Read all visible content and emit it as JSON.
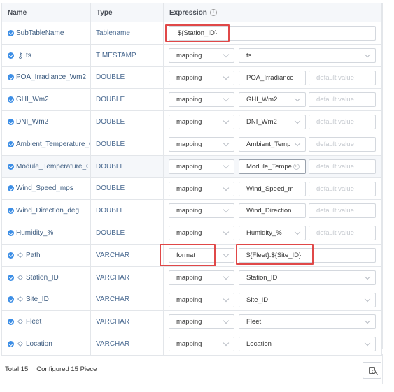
{
  "header": {
    "name": "Name",
    "type": "Type",
    "expression": "Expression",
    "info_icon": "info-icon"
  },
  "rows": [
    {
      "name": "SubTableName",
      "type": "Tablename",
      "icon": "",
      "expr_value": "${Station_ID}"
    },
    {
      "name": "ts",
      "type": "TIMESTAMP",
      "icon": "key-icon",
      "mode": "mapping",
      "target": "ts"
    },
    {
      "name": "POA_Irradiance_Wm2",
      "type": "DOUBLE",
      "mode": "mapping",
      "target": "POA_Irradiance",
      "default": "default value"
    },
    {
      "name": "GHI_Wm2",
      "type": "DOUBLE",
      "mode": "mapping",
      "target": "GHI_Wm2",
      "default": "default value"
    },
    {
      "name": "DNI_Wm2",
      "type": "DOUBLE",
      "mode": "mapping",
      "target": "DNI_Wm2",
      "default": "default value"
    },
    {
      "name": "Ambient_Temperature_C",
      "type": "DOUBLE",
      "mode": "mapping",
      "target": "Ambient_Temp",
      "default": "default value"
    },
    {
      "name": "Module_Temperature_C",
      "type": "DOUBLE",
      "mode": "mapping",
      "target": "Module_Tempe",
      "default": "default value"
    },
    {
      "name": "Wind_Speed_mps",
      "type": "DOUBLE",
      "mode": "mapping",
      "target": "Wind_Speed_m",
      "default": "default value"
    },
    {
      "name": "Wind_Direction_deg",
      "type": "DOUBLE",
      "mode": "mapping",
      "target": "Wind_Direction",
      "default": "default value"
    },
    {
      "name": "Humidity_%",
      "type": "DOUBLE",
      "mode": "mapping",
      "target": "Humidity_%",
      "default": "default value"
    },
    {
      "name": "Path",
      "type": "VARCHAR",
      "icon": "tag-icon",
      "mode": "format",
      "target": "${Fleet}.${Site_ID}"
    },
    {
      "name": "Station_ID",
      "type": "VARCHAR",
      "icon": "tag-icon",
      "mode": "mapping",
      "target": "Station_ID"
    },
    {
      "name": "Site_ID",
      "type": "VARCHAR",
      "icon": "tag-icon",
      "mode": "mapping",
      "target": "Site_ID"
    },
    {
      "name": "Fleet",
      "type": "VARCHAR",
      "icon": "tag-icon",
      "mode": "mapping",
      "target": "Fleet"
    },
    {
      "name": "Location",
      "type": "VARCHAR",
      "icon": "tag-icon",
      "mode": "mapping",
      "target": "Location"
    }
  ],
  "footer": {
    "total": "Total 15",
    "configured": "Configured 15 Piece"
  },
  "colors": {
    "accent": "#3c8ee6",
    "highlight_box": "#e04848",
    "border": "#e3e6ea"
  }
}
